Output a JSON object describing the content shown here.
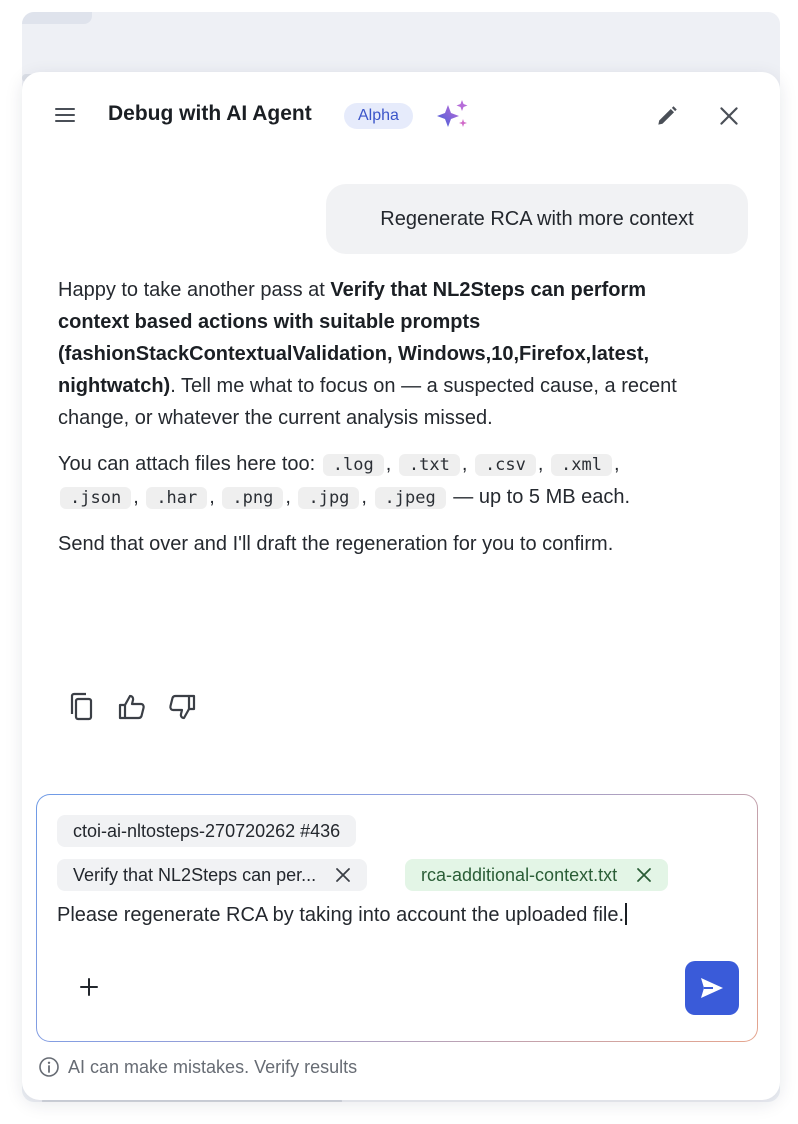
{
  "header": {
    "title": "Debug with AI Agent",
    "badge": "Alpha",
    "icons": [
      "menu-icon",
      "sparkle-icon",
      "pencil-icon",
      "close-icon"
    ]
  },
  "conversation": {
    "user_message": "Regenerate RCA with more context",
    "assistant": {
      "p1_intro": "Happy to take another pass at ",
      "p1_bold": "Verify that NL2Steps can perform context based actions with suitable prompts (fashionStackContextualValidation, Windows,10,Firefox,latest, nightwatch)",
      "p1_rest": ". Tell me what to focus on — a suspected cause, a recent change, or whatever the current analysis missed.",
      "p2_intro": "You can attach files here too: ",
      "file_types": [
        ".log",
        ".txt",
        ".csv",
        ".xml",
        ".json",
        ".har",
        ".png",
        ".jpg",
        ".jpeg"
      ],
      "p2_rest": " — up to 5 MB each.",
      "p3": "Send that over and I'll draft the regeneration for you to confirm."
    },
    "feedback_icons": [
      "copy-icon",
      "thumbs-up-icon",
      "thumbs-down-icon"
    ]
  },
  "composer": {
    "context_chip": "ctoi-ai-nltosteps-270720262 #436",
    "test_chip": "Verify that NL2Steps can per...",
    "file_chip": "rca-additional-context.txt",
    "input_value": "Please regenerate RCA by taking into account the uploaded file."
  },
  "footer": {
    "disclaimer": "AI can make mistakes. Verify results"
  },
  "colors": {
    "accent": "#3a5bd9",
    "badge_bg": "#e6ebfb",
    "file_chip_bg": "#e3f5e6"
  }
}
